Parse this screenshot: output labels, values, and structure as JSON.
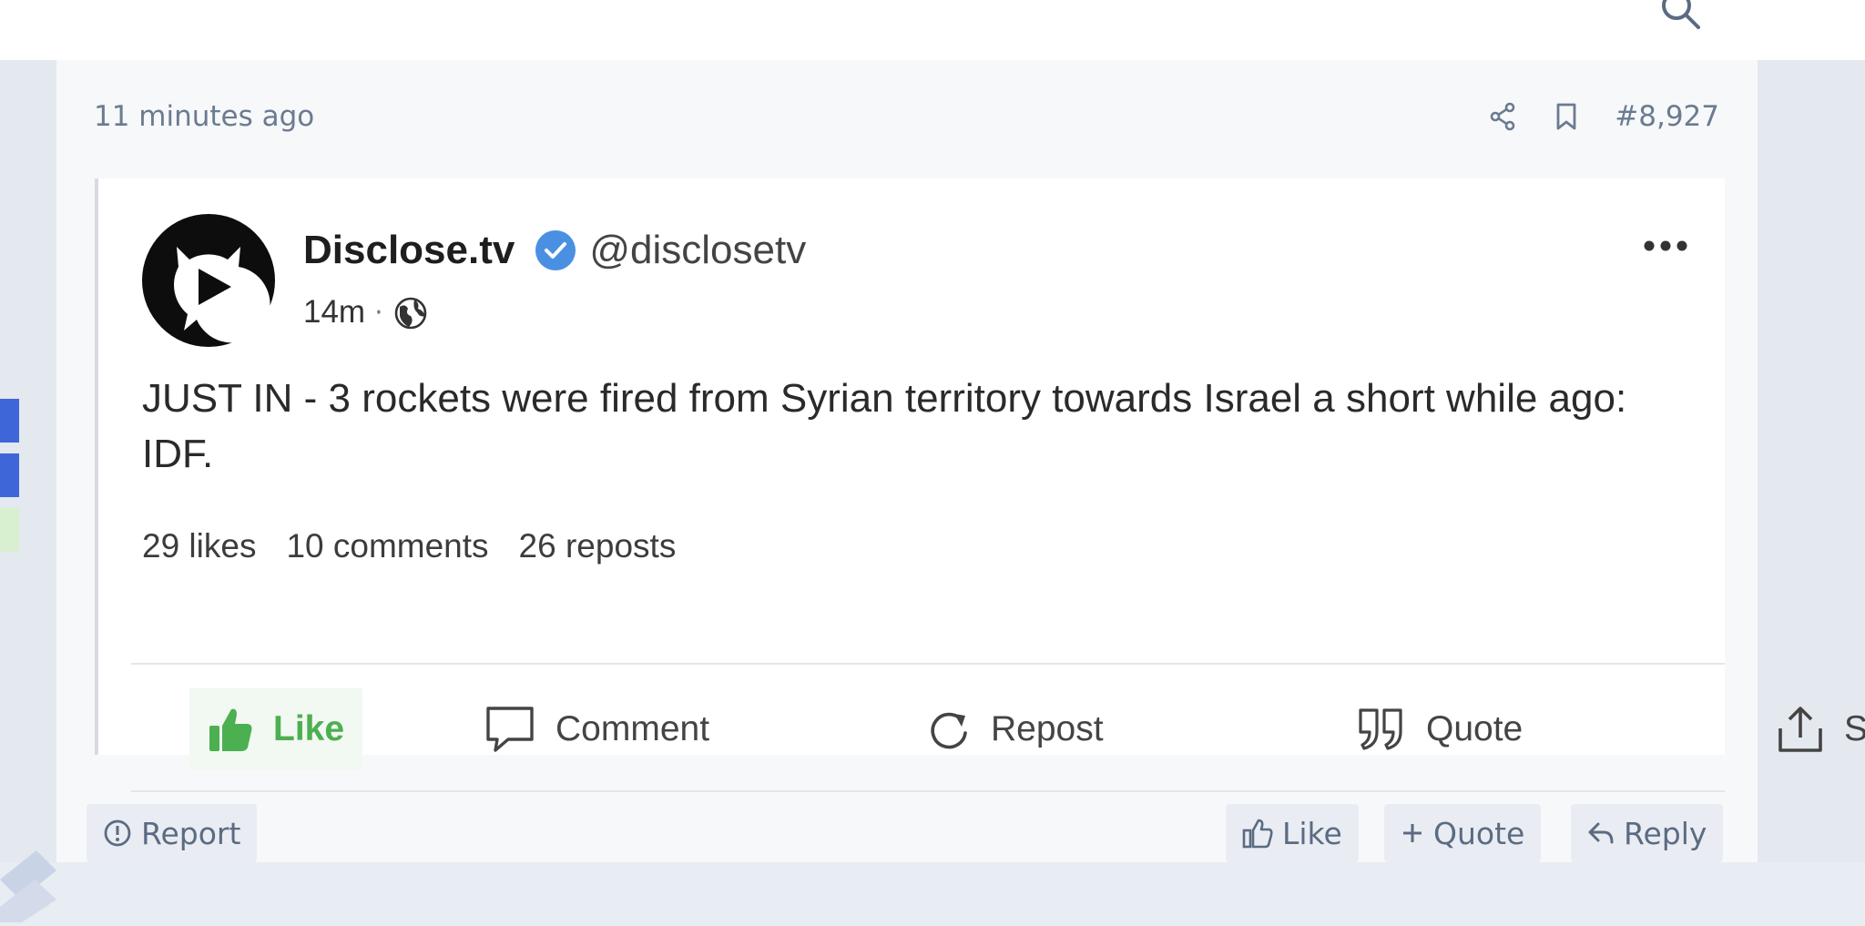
{
  "post": {
    "timestamp": "11 minutes ago",
    "number": "#8,927"
  },
  "embed": {
    "author_name": "Disclose.tv",
    "author_handle": "@disclosetv",
    "age": "14m",
    "separator": "·",
    "text": "JUST IN - 3 rockets were fired from Syrian territory towards Israel a short while ago: IDF.",
    "stats": {
      "likes": "29 likes",
      "comments": "10 comments",
      "reposts": "26 reposts"
    },
    "actions": {
      "like": "Like",
      "comment": "Comment",
      "repost": "Repost",
      "quote": "Quote",
      "share": "Share"
    }
  },
  "footer": {
    "report": "Report",
    "like": "Like",
    "quote": "Quote",
    "reply": "Reply"
  },
  "icons": {
    "search": "search-icon",
    "share": "share-icon",
    "bookmark": "bookmark-icon",
    "verified": "verified-badge-icon",
    "globe": "globe-icon",
    "more": "more-options-icon",
    "thumbs_up": "thumbs-up-icon",
    "comment": "comment-icon",
    "repost": "repost-icon",
    "quote": "quote-icon",
    "upload": "share-upload-icon",
    "report": "report-icon",
    "plus": "plus-icon",
    "reply": "reply-icon"
  },
  "colors": {
    "accent_blue": "#3f66d8",
    "like_green": "#4caf50",
    "verified_blue": "#4a90e2",
    "muted_text": "#6b7b90"
  }
}
